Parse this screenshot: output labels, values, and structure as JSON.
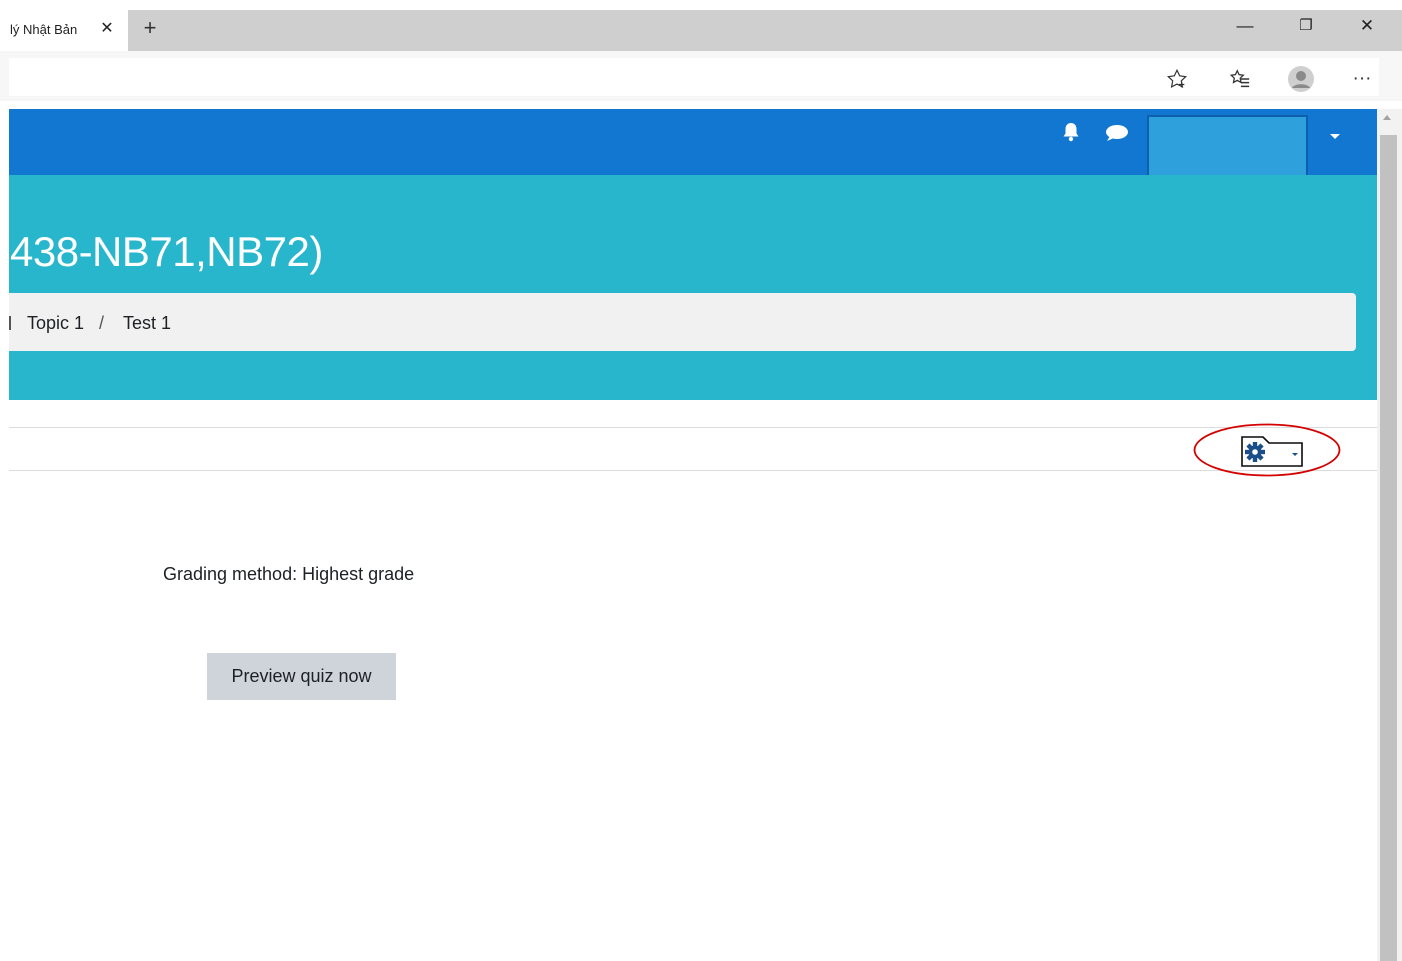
{
  "browser": {
    "tab_title": "lý Nhật Bản",
    "tab_close_glyph": "✕",
    "new_tab_glyph": "+",
    "window_controls": {
      "minimize": "—",
      "restore": "❐",
      "close": "✕"
    },
    "toolbar_icons": [
      "favorite-star-icon",
      "favorites-list-icon",
      "profile-icon",
      "more-options-icon"
    ],
    "more_glyph": "···"
  },
  "navbar": {
    "color": "#1177d1",
    "icons": [
      "notification-bell-icon",
      "messages-icon",
      "user-menu-caret-icon"
    ]
  },
  "header": {
    "course_title": "438-NB71,NB72)",
    "breadcrumb": [
      {
        "label": "Topic 1"
      },
      {
        "label": "Test 1"
      }
    ],
    "breadcrumb_separator": "/",
    "color": "#27b6cc"
  },
  "quiz": {
    "grading_method": "Grading method: Highest grade",
    "preview_button": "Preview quiz now"
  },
  "annotation": {
    "highlight_color": "#d40000"
  }
}
